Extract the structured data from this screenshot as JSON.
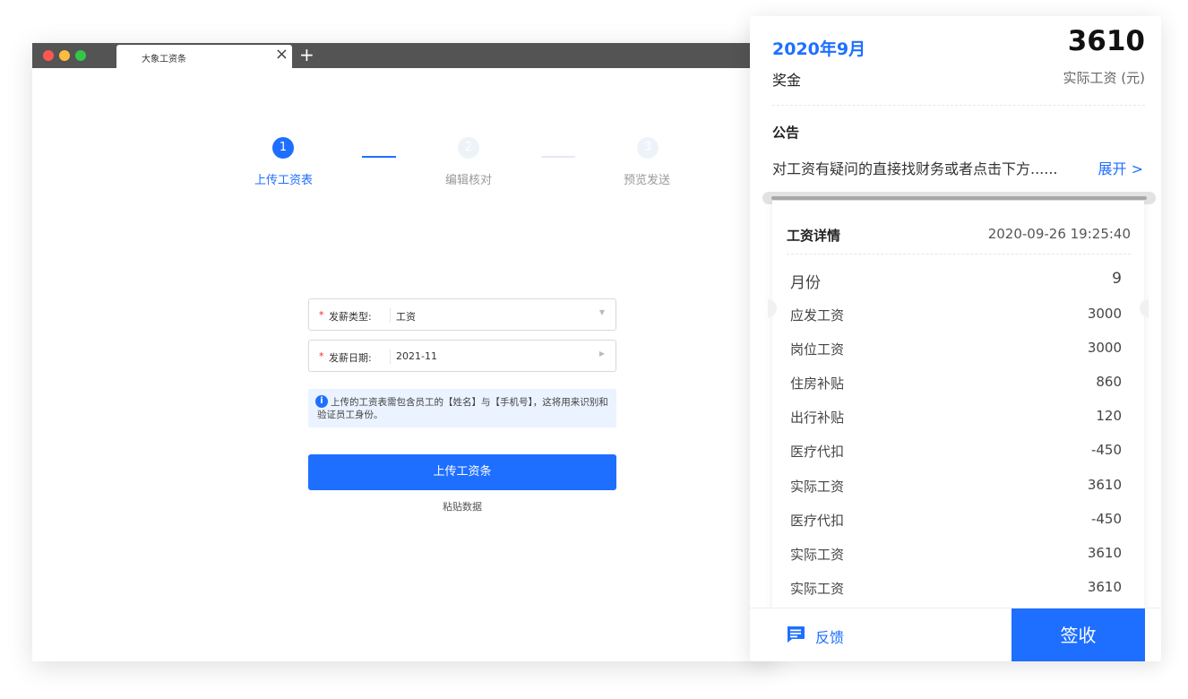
{
  "browser": {
    "tab_title": "大象工资条",
    "tab_close": "×",
    "tab_add": "+"
  },
  "steps": [
    {
      "number": "1",
      "label": "上传工资表",
      "state": "active"
    },
    {
      "number": "2",
      "label": "编辑核对",
      "state": "inactive"
    },
    {
      "number": "3",
      "label": "预览发送",
      "state": "inactive"
    }
  ],
  "form": {
    "required_mark": "*",
    "pay_type": {
      "label": "发薪类型:",
      "value": "工资"
    },
    "pay_date": {
      "label": "发薪日期:",
      "value": "2021-11"
    },
    "notice_icon": "i",
    "notice": "上传的工资表需包含员工的【姓名】与【手机号】，这将用来识别和验证员工身份。",
    "upload_button": "上传工资条",
    "paste_link": "粘贴数据"
  },
  "panel": {
    "month": "2020年9月",
    "amount": "3610",
    "bonus_label": "奖金",
    "salary_label": "实际工资 (元)",
    "notice_title": "公告",
    "notice_text": "对工资有疑问的直接找财务或者点击下方......",
    "expand": "展开 >",
    "detail": {
      "title": "工资详情",
      "time": "2020-09-26 19:25:40",
      "rows": [
        {
          "k": "月份",
          "v": "9"
        },
        {
          "k": "应发工资",
          "v": "3000"
        },
        {
          "k": "岗位工资",
          "v": "3000"
        },
        {
          "k": "住房补贴",
          "v": "860"
        },
        {
          "k": "出行补贴",
          "v": "120"
        },
        {
          "k": "医疗代扣",
          "v": "-450"
        },
        {
          "k": "实际工资",
          "v": "3610"
        },
        {
          "k": "医疗代扣",
          "v": "-450"
        },
        {
          "k": "实际工资",
          "v": "3610"
        },
        {
          "k": "实际工资",
          "v": "3610"
        }
      ]
    },
    "feedback": "反馈",
    "sign": "签收"
  },
  "colors": {
    "accent": "#1e6fff",
    "required": "#f5222d",
    "notice_bg": "#eaf3ff"
  }
}
